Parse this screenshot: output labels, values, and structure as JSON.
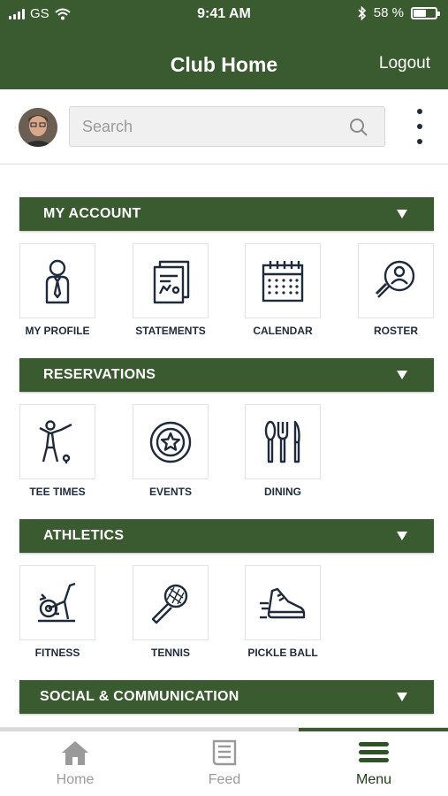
{
  "status_bar": {
    "carrier": "GS",
    "time": "9:41 AM",
    "battery_text": "58 %",
    "battery_level": 0.58
  },
  "header": {
    "title": "Club Home",
    "logout_label": "Logout"
  },
  "search": {
    "placeholder": "Search"
  },
  "sections": [
    {
      "label": "MY ACCOUNT",
      "tiles": [
        {
          "label": "MY PROFILE",
          "icon": "profile-icon"
        },
        {
          "label": "STATEMENTS",
          "icon": "statements-icon"
        },
        {
          "label": "CALENDAR",
          "icon": "calendar-icon"
        },
        {
          "label": "ROSTER",
          "icon": "roster-icon"
        }
      ]
    },
    {
      "label": "RESERVATIONS",
      "tiles": [
        {
          "label": "TEE TIMES",
          "icon": "golfer-icon"
        },
        {
          "label": "EVENTS",
          "icon": "star-badge-icon"
        },
        {
          "label": "DINING",
          "icon": "cutlery-icon"
        }
      ]
    },
    {
      "label": "ATHLETICS",
      "tiles": [
        {
          "label": "FITNESS",
          "icon": "exercise-bike-icon"
        },
        {
          "label": "TENNIS",
          "icon": "tennis-racket-icon"
        },
        {
          "label": "PICKLE BALL",
          "icon": "sneaker-icon"
        }
      ]
    },
    {
      "label": "SOCIAL & COMMUNICATION",
      "tiles": []
    }
  ],
  "tabbar": {
    "tabs": [
      {
        "label": "Home",
        "icon": "home-icon",
        "active": false
      },
      {
        "label": "Feed",
        "icon": "feed-icon",
        "active": false
      },
      {
        "label": "Menu",
        "icon": "menu-icon",
        "active": true
      }
    ]
  },
  "colors": {
    "brand_green": "#3a5a2f",
    "icon_navy": "#1f2a3a",
    "inactive_gray": "#9a9a9a"
  }
}
